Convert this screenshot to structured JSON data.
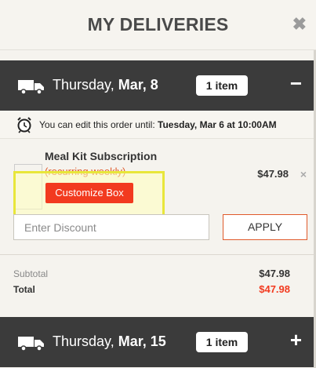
{
  "header": {
    "title": "MY DELIVERIES",
    "close_icon": "close-icon"
  },
  "deliveries": [
    {
      "day": "Thursday,",
      "date": "Mar, 8",
      "badge": "1 item",
      "toggle": "−",
      "expanded": true
    },
    {
      "day": "Thursday,",
      "date": "Mar, 15",
      "badge": "1 item",
      "toggle": "+",
      "expanded": false
    }
  ],
  "deadline": {
    "prefix": "You can edit this order until:",
    "datetime": "Tuesday, Mar 6 at 10:00AM"
  },
  "product": {
    "name": "Meal Kit Subscription",
    "recurrence": "(recurring weekly)",
    "customize_label": "Customize Box",
    "price": "$47.98",
    "remove": "×"
  },
  "discount": {
    "placeholder": "Enter Discount",
    "value": "",
    "apply_label": "APPLY"
  },
  "summary": {
    "subtotal_label": "Subtotal",
    "subtotal_value": "$47.98",
    "total_label": "Total",
    "total_value": "$47.98"
  },
  "colors": {
    "accent": "#f23a1f",
    "bar": "#3b3b3b",
    "highlight": "#e8e63a"
  }
}
